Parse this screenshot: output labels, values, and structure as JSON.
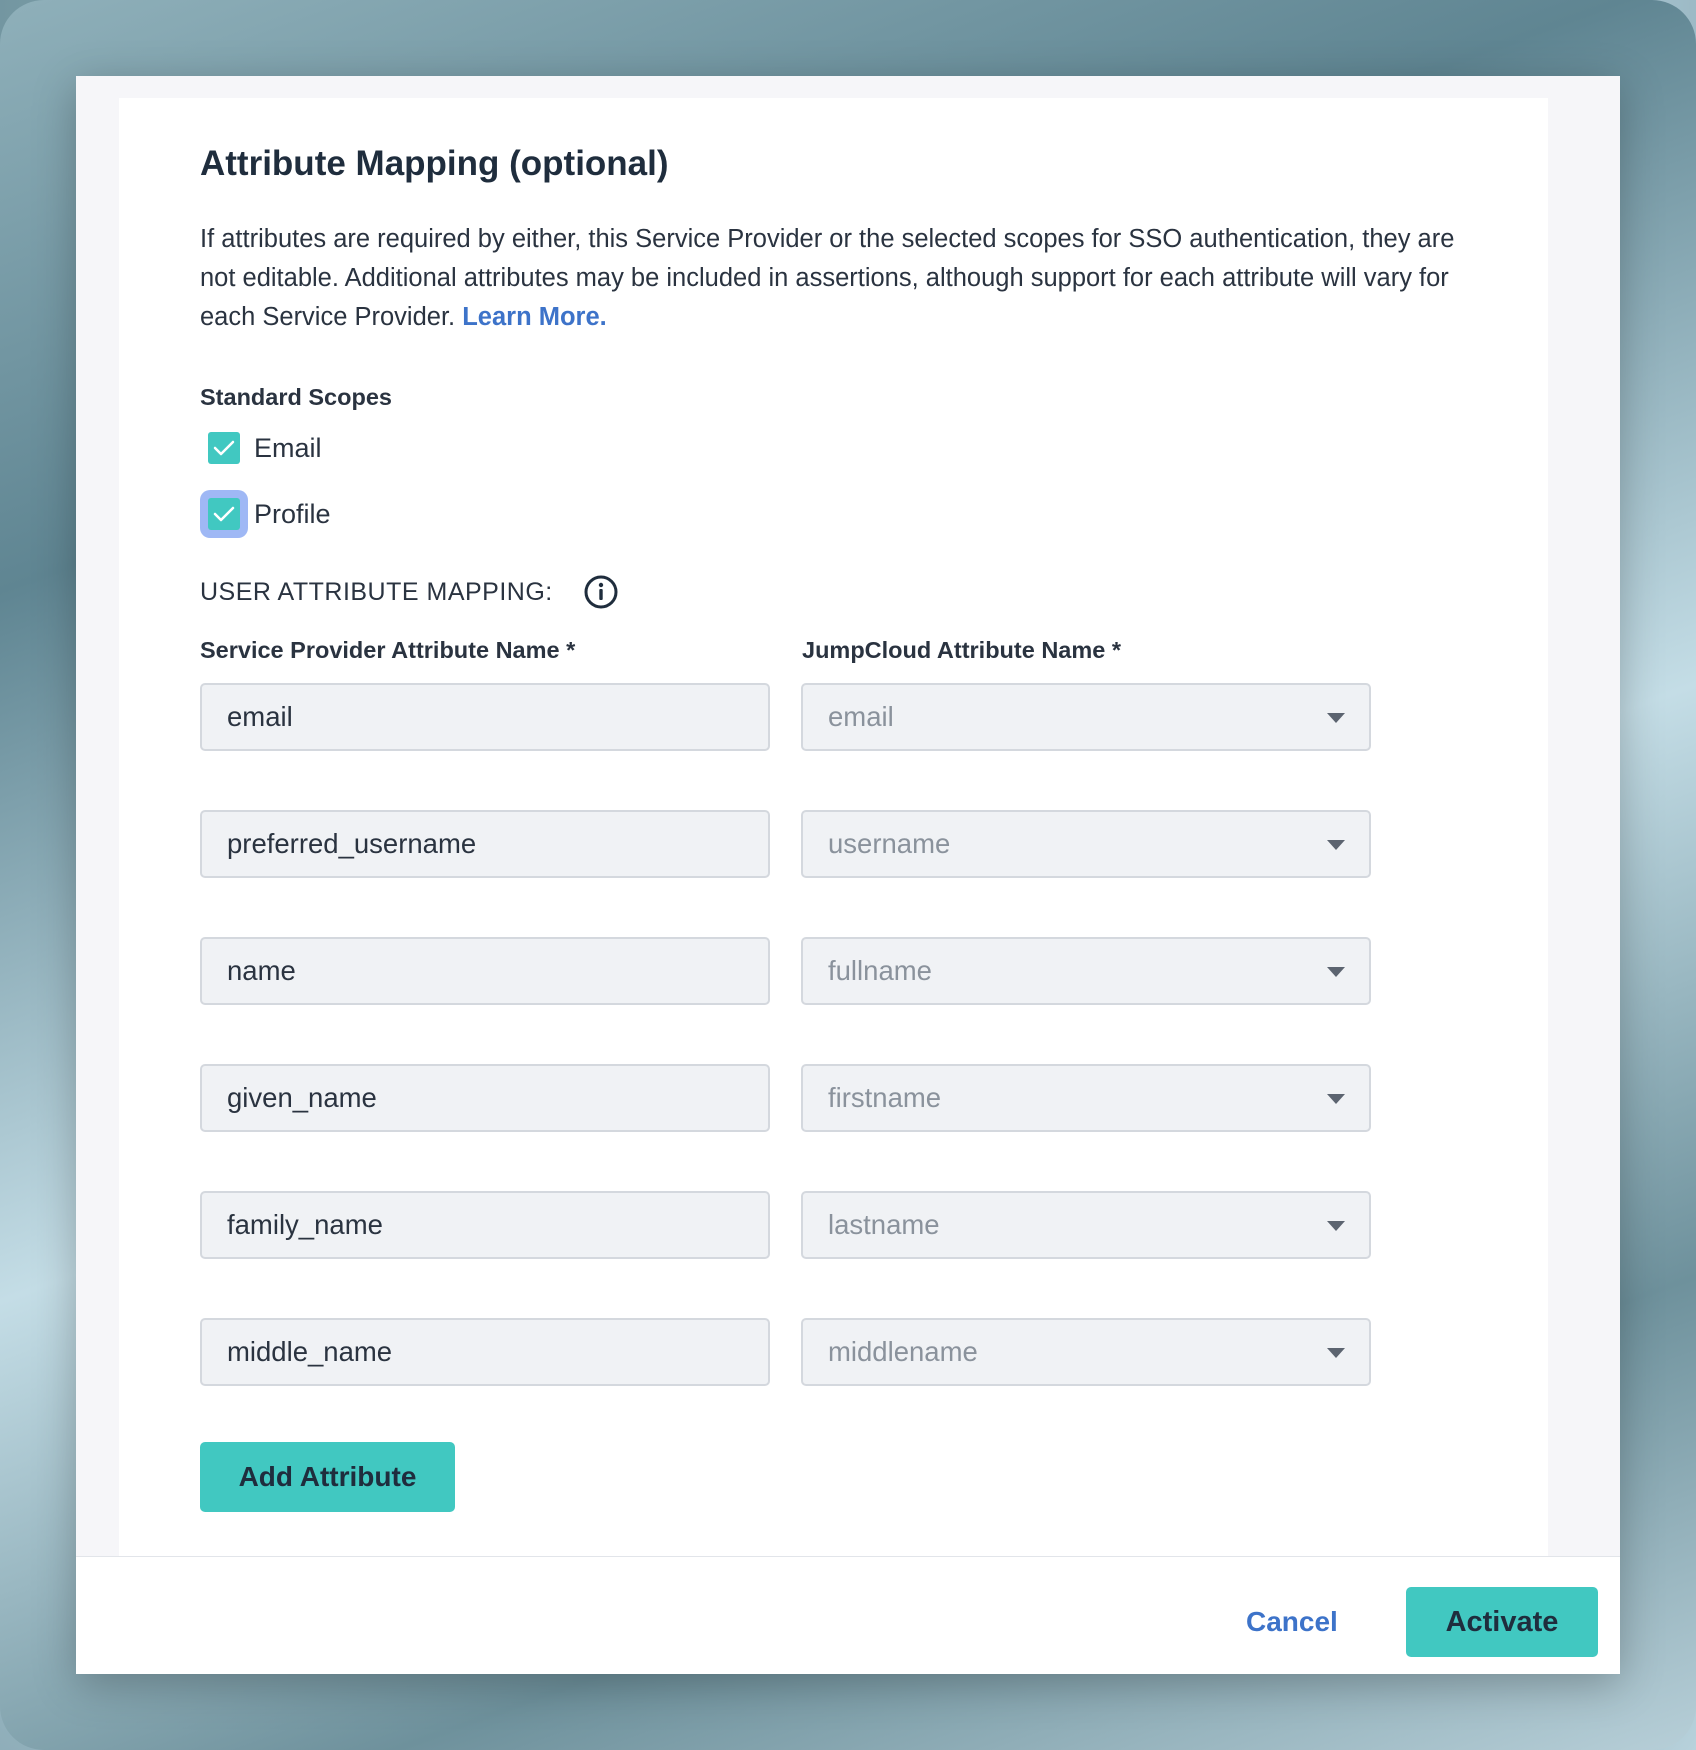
{
  "dialog": {
    "title": "Attribute Mapping (optional)",
    "description": "If attributes are required by either, this Service Provider or the selected scopes for SSO authentication, they are not editable. Additional attributes may be included in assertions, although support for each attribute will vary for each Service Provider.",
    "learn_more": "Learn More."
  },
  "scopes": {
    "label": "Standard Scopes",
    "items": [
      {
        "label": "Email",
        "checked": true
      },
      {
        "label": "Profile",
        "checked": true
      }
    ]
  },
  "mapping": {
    "section_label": "USER ATTRIBUTE MAPPING:",
    "info_icon": "info-icon",
    "col_service_provider": "Service Provider Attribute Name *",
    "col_jumpcloud": "JumpCloud Attribute Name *",
    "rows": [
      {
        "sp": "email",
        "jc": "email"
      },
      {
        "sp": "preferred_username",
        "jc": "username"
      },
      {
        "sp": "name",
        "jc": "fullname"
      },
      {
        "sp": "given_name",
        "jc": "firstname"
      },
      {
        "sp": "family_name",
        "jc": "lastname"
      },
      {
        "sp": "middle_name",
        "jc": "middlename"
      }
    ],
    "add_button": "Add Attribute"
  },
  "footer": {
    "cancel": "Cancel",
    "activate": "Activate"
  },
  "colors": {
    "accent": "#41c8c1",
    "link": "#3d73c9",
    "focus_ring": "#9fb8f5"
  }
}
